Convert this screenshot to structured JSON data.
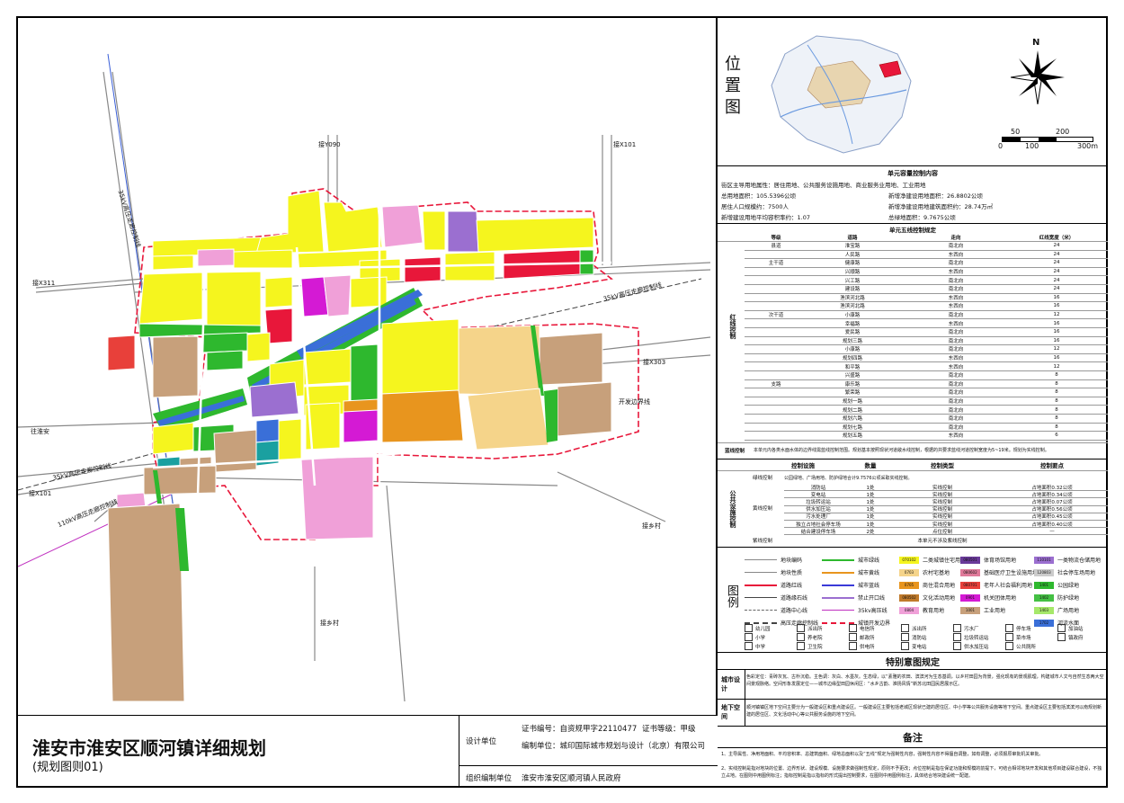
{
  "map": {
    "road_labels": {
      "y090": "接Y090",
      "x101_top": "接X101",
      "x311": "接X311",
      "x303": "接X303",
      "huaian": "往淮安",
      "x101_left": "接X101",
      "xiangcun_right": "接乡村",
      "xiangcun_bottom": "接乡村",
      "dev_boundary": "开发边界线",
      "hv_35kv_a": "35kV高压走廊控制线",
      "hv_35kv_b": "35kV高压走廊控制线",
      "hv_35kv_c": "35kV高压走廊控制线",
      "hv_110kv": "110kV高压走廊控制线"
    },
    "colors": {
      "residential": "#f5f51e",
      "commercial": "#e8173a",
      "public": "#d41ad4",
      "industrial": "#c7a07b",
      "green": "#2eb82e",
      "education": "#f0a0d8",
      "culture": "#9b6fd0",
      "water": "#3a6fd8",
      "rural": "#f5d48a",
      "mixed": "#e8951e",
      "red_line": "#e8173a",
      "road_line": "#777777"
    }
  },
  "title_block": {
    "title": "淮安市淮安区顺河镇详细规划",
    "subtitle": "(规划图则01)",
    "design_unit_label": "设计单位",
    "cert_no": "证书编号：自资规甲字22110477",
    "cert_level": "证书等级：甲级",
    "compiler": "编制单位：城印国际城市规划与设计（北京）有限公司",
    "org_label": "组织编制单位",
    "org": "淮安市淮安区顺河镇人民政府"
  },
  "location": {
    "title": "位置图",
    "north": "N",
    "scale_top": [
      "50",
      "200"
    ],
    "scale_bottom": [
      "0",
      "100",
      "300m"
    ]
  },
  "capacity": {
    "title": "单元容量控制内容",
    "row1": "街区主导用地属性：居住用地、公共服务设施用地、商业服务业用地、工业用地",
    "total_area": "总用地面积：105.5396公顷",
    "new_land": "新增净建设用地面积：26.8802公顷",
    "population": "居住人口规模约：7500人",
    "new_floor": "新增净建设用地建筑面积约：28.74万㎡",
    "far": "新增建设用地平均容积率约：1.07",
    "green_area": "总绿地面积：9.7675公顷"
  },
  "fivelines": {
    "title": "单元五线控制规定",
    "headers": [
      "等级",
      "道路",
      "走向",
      "红线宽度（米）"
    ],
    "section_red": "红线控制",
    "rows": [
      {
        "grade": "县道",
        "road": "淮宝路",
        "dir": "南北向",
        "width": "24"
      },
      {
        "grade": "",
        "road": "人民路",
        "dir": "东西向",
        "width": "24"
      },
      {
        "grade": "主干道",
        "road": "健康路",
        "dir": "南北向",
        "width": "24"
      },
      {
        "grade": "",
        "road": "兴顺路",
        "dir": "东西向",
        "width": "24"
      },
      {
        "grade": "",
        "road": "兴工路",
        "dir": "南北向",
        "width": "24"
      },
      {
        "grade": "",
        "road": "建设路",
        "dir": "南北向",
        "width": "24"
      },
      {
        "grade": "",
        "road": "渔滨河北路",
        "dir": "东西向",
        "width": "16"
      },
      {
        "grade": "",
        "road": "渔滨河北路",
        "dir": "东西向",
        "width": "16"
      },
      {
        "grade": "次干道",
        "road": "小康路",
        "dir": "南北向",
        "width": "12"
      },
      {
        "grade": "",
        "road": "幸福路",
        "dir": "东西向",
        "width": "16"
      },
      {
        "grade": "",
        "road": "爱民路",
        "dir": "南北向",
        "width": "16"
      },
      {
        "grade": "",
        "road": "规划三路",
        "dir": "南北向",
        "width": "16"
      },
      {
        "grade": "",
        "road": "小康路",
        "dir": "南北向",
        "width": "12"
      },
      {
        "grade": "",
        "road": "规划四路",
        "dir": "东西向",
        "width": "16"
      },
      {
        "grade": "",
        "road": "和平路",
        "dir": "东西向",
        "width": "12"
      },
      {
        "grade": "",
        "road": "兴盛路",
        "dir": "南北向",
        "width": "8"
      },
      {
        "grade": "支路",
        "road": "康乐路",
        "dir": "南北向",
        "width": "8"
      },
      {
        "grade": "",
        "road": "繁荣路",
        "dir": "南北向",
        "width": "8"
      },
      {
        "grade": "",
        "road": "规划一路",
        "dir": "南北向",
        "width": "8"
      },
      {
        "grade": "",
        "road": "规划二路",
        "dir": "南北向",
        "width": "8"
      },
      {
        "grade": "",
        "road": "规划六路",
        "dir": "南北向",
        "width": "8"
      },
      {
        "grade": "",
        "road": "规划七路",
        "dir": "南北向",
        "width": "8"
      },
      {
        "grade": "",
        "road": "规划五路",
        "dir": "东西向",
        "width": "6"
      }
    ],
    "blue_label": "蓝线控制",
    "blue_text": "本单元内各类水面水体的边界线需蓝线控制范围。规划基本按照现状河道敞水线控制，根据的共要求蓝线河道控制宽度为5~19米。规划为实线控制。"
  },
  "facilities": {
    "headers": [
      "控制设施",
      "数量",
      "控制类型",
      "控制要点"
    ],
    "section": "公共设施控制",
    "green_label": "绿线控制",
    "green_text": "公园绿地、广场用地、防护绿地合计9.7576公顷采取实线控制。",
    "yellow_label": "黄线控制",
    "rows": [
      {
        "name": "消防站",
        "qty": "1处",
        "type": "实线控制",
        "note": "占地面积0.32公顷"
      },
      {
        "name": "变电站",
        "qty": "1处",
        "type": "实线控制",
        "note": "占地面积0.34公顷"
      },
      {
        "name": "垃圾转运站",
        "qty": "1处",
        "type": "实线控制",
        "note": "占地面积0.07公顷"
      },
      {
        "name": "供水加压站",
        "qty": "1处",
        "type": "实线控制",
        "note": "占地面积0.56公顷"
      },
      {
        "name": "污水处理厂",
        "qty": "1处",
        "type": "实线控制",
        "note": "占地面积0.45公顷"
      },
      {
        "name": "独立占地社会停车场",
        "qty": "1处",
        "type": "实线控制",
        "note": "占地面积0.40公顷"
      },
      {
        "name": "结合建设停车场",
        "qty": "2处",
        "type": "点位控制",
        "note": "—"
      }
    ],
    "purple_label": "紫线控制",
    "purple_text": "本单元不涉及紫线控制"
  },
  "legend": {
    "title": "图例",
    "col1": [
      "地块编码",
      "地块性质",
      "道路红线",
      "道路缘石线",
      "道路中心线",
      "高压走廊控制线"
    ],
    "col2": [
      "城市绿线",
      "城市黄线",
      "城市蓝线",
      "禁止开口线",
      "35kv高压线",
      "城镇开发边界"
    ],
    "col3": [
      {
        "code": "070102",
        "label": "二类城镇住宅用地",
        "color": "#f5f51e"
      },
      {
        "code": "0703",
        "label": "农村宅基地",
        "color": "#f5d48a"
      },
      {
        "code": "0705",
        "label": "商住混合用地",
        "color": "#e8951e"
      },
      {
        "code": "080502",
        "label": "文化活动用地",
        "color": "#c07a2a"
      },
      {
        "code": "0804",
        "label": "教育用地",
        "color": "#f0a0d8"
      }
    ],
    "col4": [
      {
        "code": "080501",
        "label": "体育场馆用地",
        "color": "#6a3a9a"
      },
      {
        "code": "080602",
        "label": "基础医疗卫生设施用地",
        "color": "#e07a9a"
      },
      {
        "code": "080701",
        "label": "老年人社会福利用地",
        "color": "#e8403a"
      },
      {
        "code": "0901",
        "label": "机关团体用地",
        "color": "#d41ad4"
      },
      {
        "code": "1001",
        "label": "工业用地",
        "color": "#c7a07b"
      }
    ],
    "col4b": [
      {
        "code": "0901",
        "label": "商业服务业用地",
        "color": "#e8173a"
      },
      {
        "code": "13",
        "label": "公用设施用地",
        "color": "#1aa0a0"
      }
    ],
    "col5": [
      {
        "code": "110101",
        "label": "一类物流仓储用地",
        "color": "#9b6fd0"
      },
      {
        "code": "120803",
        "label": "社会停车场用地",
        "color": "#cccccc"
      },
      {
        "code": "1401",
        "label": "公园绿地",
        "color": "#2eb82e"
      },
      {
        "code": "1402",
        "label": "防护绿地",
        "color": "#44c044"
      },
      {
        "code": "1403",
        "label": "广场用地",
        "color": "#a6e86a"
      },
      {
        "code": "1702",
        "label": "河流水面",
        "color": "#3a6fd8"
      }
    ],
    "icons": [
      "幼儿园",
      "派出所",
      "电信所",
      "派出所",
      "污水厂",
      "停车场",
      "加油站",
      "小学",
      "养老院",
      "邮政所",
      "消防站",
      "垃圾转运站",
      "菜市场",
      "镇政府",
      "中学",
      "卫生院",
      "供电所",
      "变电站",
      "供水加压站",
      "公共厕所"
    ]
  },
  "special": {
    "title": "特别意图规定",
    "design_label": "城市设计",
    "design_text": "色彩定位：青砖灰瓦、古朴沉稳。主色调：灰白、水墨灰。生态绿，以“素雅的农田、滨滨河为生态基调，以乡村田园为背景，强化现有的景观肌理，构建城市人文与自然生态两大空间景观脉络。空间形象发展定位——城市边缘型田园休闲区：“水乡古韵、淮扬风情”新苏北田园民居展示区。",
    "underground_label": "地下空间",
    "underground_text": "顺河镇镇区地下空间主要分为一般建设区和重点建设区。一般建设区主要包括老城区现状已建的居住区、中小学等公共服务设施等地下空间。重点建设区主要包括滨滨河以南规划新建的居住区、文化活动中心等公共服务设施的地下空间。"
  },
  "notes": {
    "title": "备注",
    "n1": "1、主导属性、净用地面积、平均容积率、总建筑面积、绿地总面积以及“五线”规定为强制性内容，强制性内容不得擅自调整，如有调整，必须报原审批机关审批。",
    "n2": "2、实线控制是指对地块的位置、边界形状、建设规模、设施要求做强制性规定，原则不予更改；点位控制是指在保证功能和规模的前提下，可结合相邻地块开发和其他项目建设联合建设，不独立占地。在图则中用图例标注；指标控制是指以指标的形式提出控制要求，在图则中用图例标注，具体结合地块建设统一配建。"
  }
}
